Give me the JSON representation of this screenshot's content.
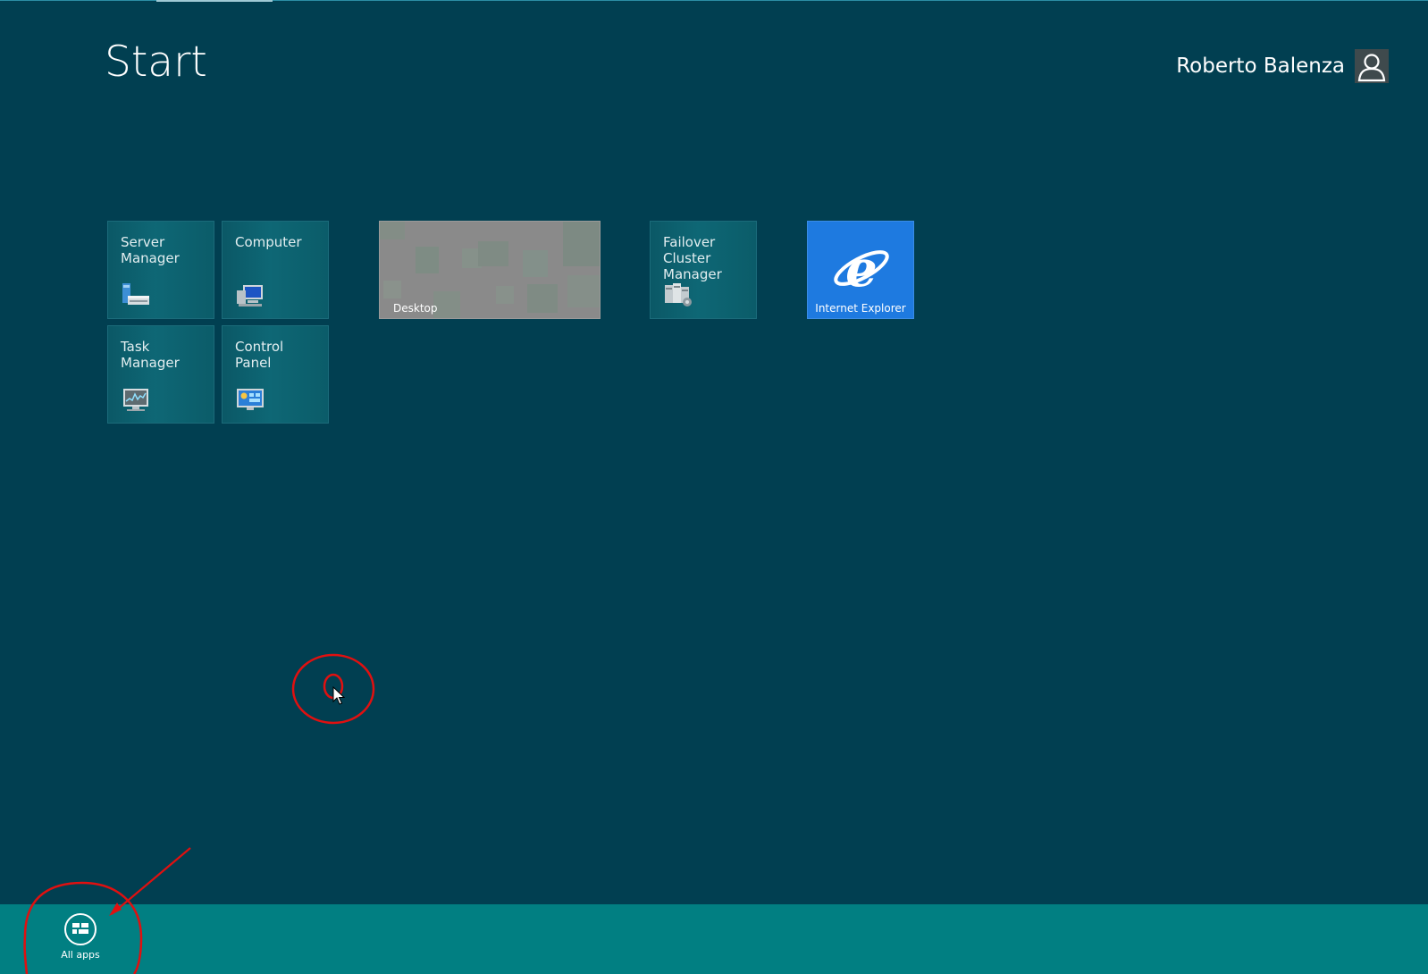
{
  "screen": {
    "title": "Start",
    "user": {
      "name": "Roberto Balenza",
      "avatar_icon": "user-silhouette-icon"
    }
  },
  "tiles": {
    "server_manager": {
      "label": "Server\nManager",
      "icon": "server-manager-icon"
    },
    "computer": {
      "label": "Computer",
      "icon": "computer-icon"
    },
    "task_manager": {
      "label": "Task\nManager",
      "icon": "task-manager-icon"
    },
    "control_panel": {
      "label": "Control\nPanel",
      "icon": "control-panel-icon"
    },
    "desktop": {
      "label": "Desktop"
    },
    "failover_cluster_manager": {
      "label": "Failover\nCluster\nManager",
      "icon": "cluster-manager-icon"
    },
    "internet_explorer": {
      "label": "Internet Explorer",
      "icon": "internet-explorer-icon"
    }
  },
  "app_bar": {
    "all_apps": {
      "label": "All apps",
      "icon": "all-apps-icon"
    }
  },
  "colors": {
    "background": "#013f51",
    "tile": "#0b5866",
    "app_bar": "#017f82",
    "ie_tile": "#1e7ae0",
    "annotation": "#e01010"
  }
}
